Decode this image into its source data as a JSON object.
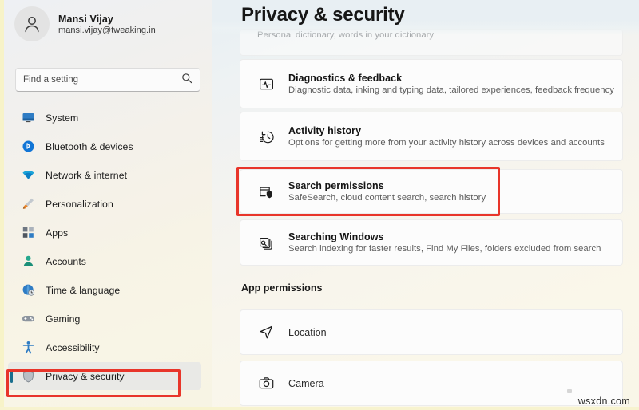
{
  "window": {
    "accent_color": "#1a6e8e",
    "annotation_color": "#e8352a"
  },
  "sidebar": {
    "profile": {
      "name": "Mansi Vijay",
      "email": "mansi.vijay@tweaking.in",
      "avatar_icon": "person-avatar-icon"
    },
    "search": {
      "placeholder": "Find a setting",
      "value": "",
      "icon": "search-icon"
    },
    "items": [
      {
        "label": "System",
        "icon": "monitor-icon",
        "selected": false
      },
      {
        "label": "Bluetooth & devices",
        "icon": "bluetooth-icon",
        "selected": false
      },
      {
        "label": "Network & internet",
        "icon": "wifi-icon",
        "selected": false
      },
      {
        "label": "Personalization",
        "icon": "paintbrush-icon",
        "selected": false
      },
      {
        "label": "Apps",
        "icon": "apps-grid-icon",
        "selected": false
      },
      {
        "label": "Accounts",
        "icon": "person-icon",
        "selected": false
      },
      {
        "label": "Time & language",
        "icon": "globe-clock-icon",
        "selected": false
      },
      {
        "label": "Gaming",
        "icon": "gamepad-icon",
        "selected": false
      },
      {
        "label": "Accessibility",
        "icon": "accessibility-icon",
        "selected": false
      },
      {
        "label": "Privacy & security",
        "icon": "shield-icon",
        "selected": true
      }
    ]
  },
  "main": {
    "title": "Privacy & security",
    "partial_card": {
      "subtitle": "Personal dictionary, words in your dictionary"
    },
    "cards": [
      {
        "title": "Diagnostics & feedback",
        "subtitle": "Diagnostic data, inking and typing data, tailored experiences, feedback frequency",
        "icon": "diagnostics-pulse-icon",
        "highlighted": false
      },
      {
        "title": "Activity history",
        "subtitle": "Options for getting more from your activity history across devices and accounts",
        "icon": "activity-history-icon",
        "highlighted": false
      },
      {
        "title": "Search permissions",
        "subtitle": "SafeSearch, cloud content search, search history",
        "icon": "search-permissions-shield-icon",
        "highlighted": true
      },
      {
        "title": "Searching Windows",
        "subtitle": "Search indexing for faster results, Find My Files, folders excluded from search",
        "icon": "searching-windows-icon",
        "highlighted": false
      }
    ],
    "section_heading": "App permissions",
    "permission_cards": [
      {
        "title": "Location",
        "icon": "location-arrow-icon"
      },
      {
        "title": "Camera",
        "icon": "camera-icon"
      }
    ]
  },
  "watermark": "wsxdn.com"
}
